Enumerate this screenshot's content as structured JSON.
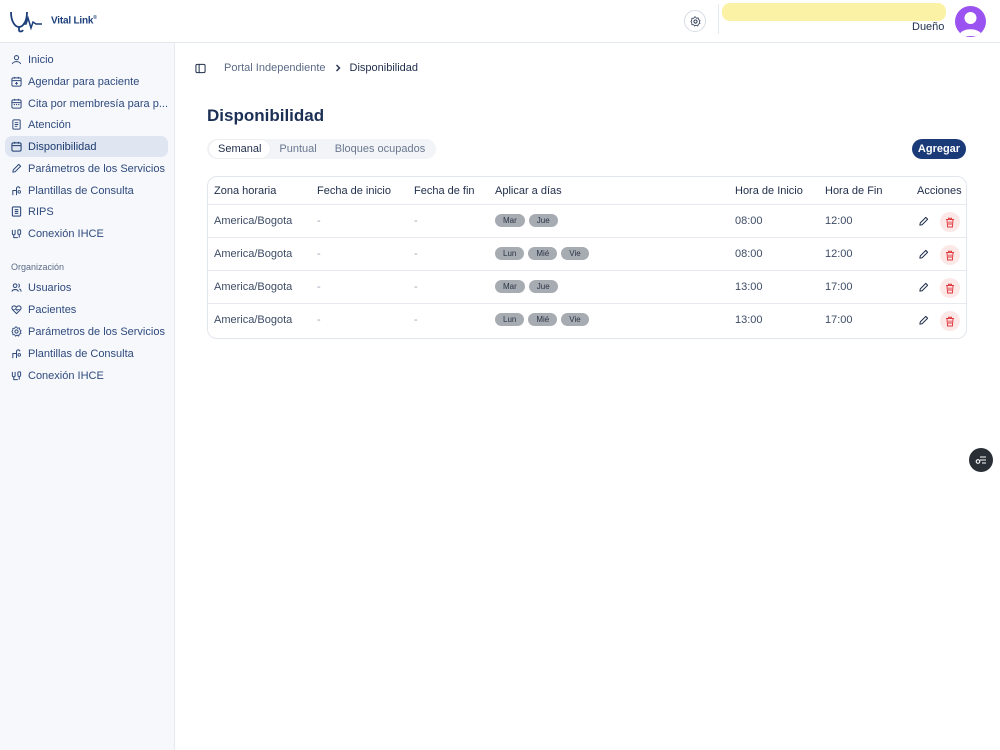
{
  "brand": {
    "name": "Vital Link",
    "mark": "®"
  },
  "header": {
    "role": "Dueño",
    "accent": "#1b3b78",
    "avatar_color": "#9a52f0"
  },
  "sidebar": {
    "items": [
      {
        "label": "Inicio",
        "icon": "user-icon"
      },
      {
        "label": "Agendar para paciente",
        "icon": "calendar-plus-icon"
      },
      {
        "label": "Cita por membresía para p...",
        "icon": "calendar-grid-icon"
      },
      {
        "label": "Atención",
        "icon": "document-icon"
      },
      {
        "label": "Disponibilidad",
        "icon": "calendar-icon",
        "active": true
      },
      {
        "label": "Parámetros de los Servicios",
        "icon": "pencil-icon"
      },
      {
        "label": "Plantillas de Consulta",
        "icon": "templates-icon"
      },
      {
        "label": "RIPS",
        "icon": "report-icon"
      },
      {
        "label": "Conexión IHCE",
        "icon": "connection-icon"
      }
    ],
    "section_label": "Organización",
    "org_items": [
      {
        "label": "Usuarios",
        "icon": "users-icon"
      },
      {
        "label": "Pacientes",
        "icon": "heart-icon"
      },
      {
        "label": "Parámetros de los Servicios",
        "icon": "gear-icon"
      },
      {
        "label": "Plantillas de Consulta",
        "icon": "templates-icon"
      },
      {
        "label": "Conexión IHCE",
        "icon": "connection-icon"
      }
    ]
  },
  "breadcrumb": {
    "parent": "Portal Independiente",
    "current": "Disponibilidad"
  },
  "page": {
    "title": "Disponibilidad"
  },
  "tabs": [
    {
      "label": "Semanal",
      "active": true
    },
    {
      "label": "Puntual"
    },
    {
      "label": "Bloques ocupados"
    }
  ],
  "add_button": "Agregar",
  "table": {
    "headers": [
      "Zona horaria",
      "Fecha de inicio",
      "Fecha de fin",
      "Aplicar a días",
      "Hora de Inicio",
      "Hora de Fin",
      "Acciones"
    ],
    "rows": [
      {
        "tz": "America/Bogota",
        "start_date": "-",
        "end_date": "-",
        "days": [
          "Mar",
          "Jue"
        ],
        "start": "08:00",
        "end": "12:00"
      },
      {
        "tz": "America/Bogota",
        "start_date": "-",
        "end_date": "-",
        "days": [
          "Lun",
          "Mié",
          "Vie"
        ],
        "start": "08:00",
        "end": "12:00"
      },
      {
        "tz": "America/Bogota",
        "start_date": "-",
        "end_date": "-",
        "days": [
          "Mar",
          "Jue"
        ],
        "start": "13:00",
        "end": "17:00"
      },
      {
        "tz": "America/Bogota",
        "start_date": "-",
        "end_date": "-",
        "days": [
          "Lun",
          "Mié",
          "Vie"
        ],
        "start": "13:00",
        "end": "17:00"
      }
    ]
  }
}
